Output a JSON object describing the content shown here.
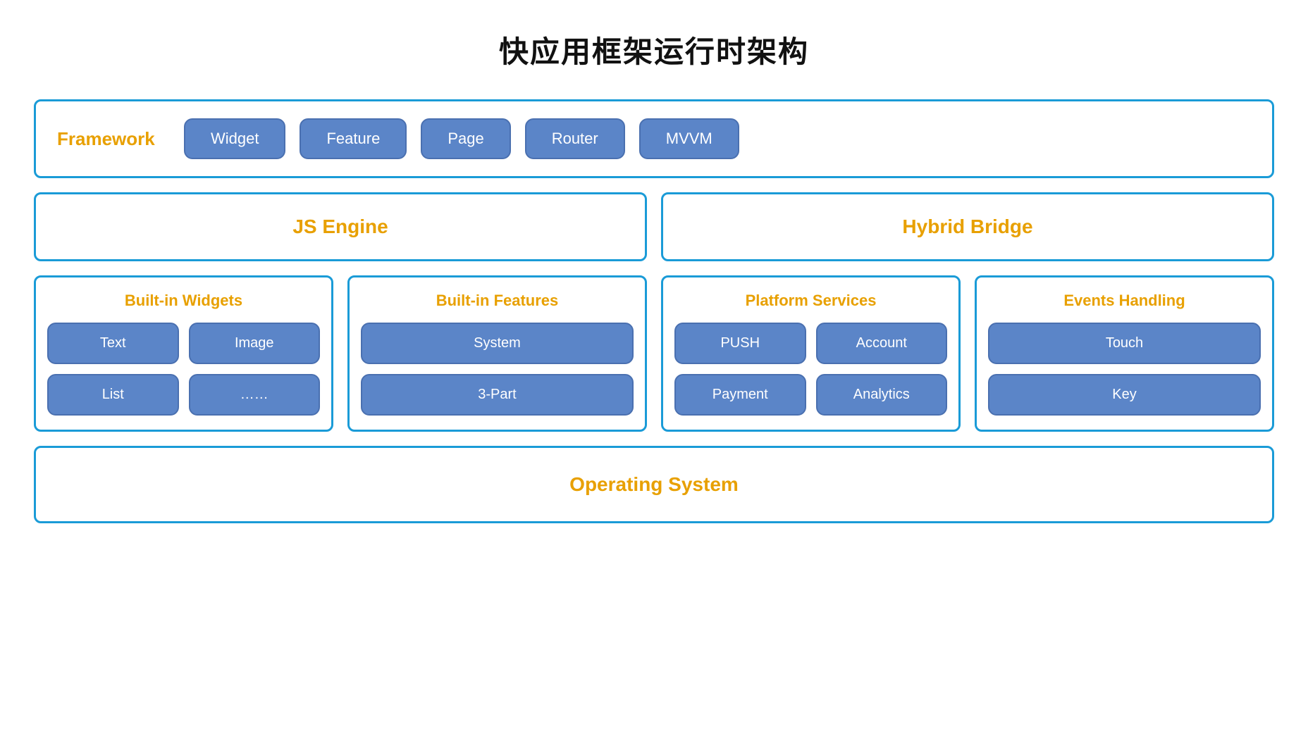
{
  "title": "快应用框架运行时架构",
  "framework": {
    "label": "Framework",
    "chips": [
      "Widget",
      "Feature",
      "Page",
      "Router",
      "MVVM"
    ]
  },
  "js_engine": {
    "label": "JS Engine"
  },
  "hybrid_bridge": {
    "label": "Hybrid Bridge"
  },
  "builtin_widgets": {
    "title": "Built-in Widgets",
    "chips": [
      "Text",
      "Image",
      "List",
      "……"
    ]
  },
  "builtin_features": {
    "title": "Built-in Features",
    "chips": [
      "System",
      "3-Part"
    ]
  },
  "platform_services": {
    "title": "Platform Services",
    "chips": [
      "PUSH",
      "Account",
      "Payment",
      "Analytics"
    ]
  },
  "events_handling": {
    "title": "Events Handling",
    "chips": [
      "Touch",
      "Key"
    ]
  },
  "operating_system": {
    "label": "Operating System"
  }
}
